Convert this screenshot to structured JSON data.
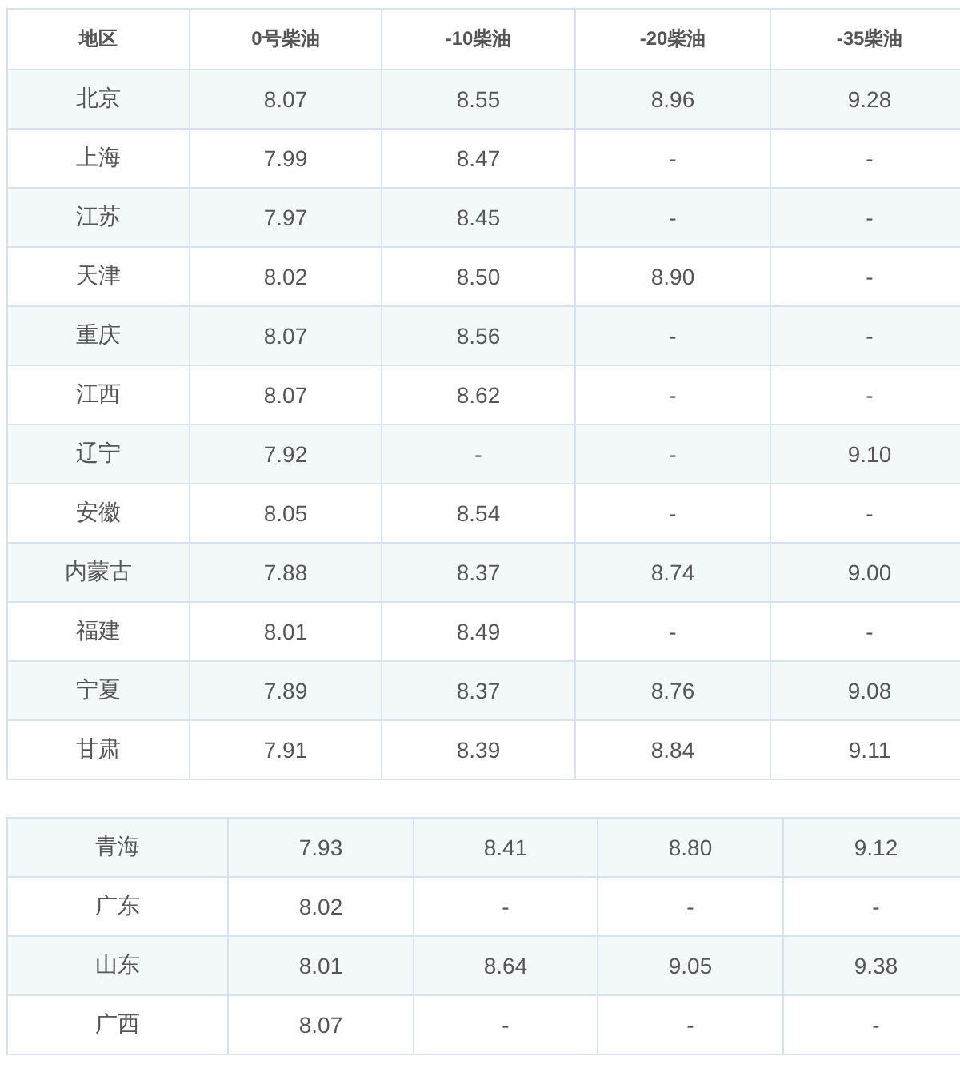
{
  "tables": [
    {
      "columns": [
        "地区",
        "0号柴油",
        "-10柴油",
        "-20柴油",
        "-35柴油"
      ],
      "rows": [
        [
          "北京",
          "8.07",
          "8.55",
          "8.96",
          "9.28"
        ],
        [
          "上海",
          "7.99",
          "8.47",
          "-",
          "-"
        ],
        [
          "江苏",
          "7.97",
          "8.45",
          "-",
          "-"
        ],
        [
          "天津",
          "8.02",
          "8.50",
          "8.90",
          "-"
        ],
        [
          "重庆",
          "8.07",
          "8.56",
          "-",
          "-"
        ],
        [
          "江西",
          "8.07",
          "8.62",
          "-",
          "-"
        ],
        [
          "辽宁",
          "7.92",
          "-",
          "-",
          "9.10"
        ],
        [
          "安徽",
          "8.05",
          "8.54",
          "-",
          "-"
        ],
        [
          "内蒙古",
          "7.88",
          "8.37",
          "8.74",
          "9.00"
        ],
        [
          "福建",
          "8.01",
          "8.49",
          "-",
          "-"
        ],
        [
          "宁夏",
          "7.89",
          "8.37",
          "8.76",
          "9.08"
        ],
        [
          "甘肃",
          "7.91",
          "8.39",
          "8.84",
          "9.11"
        ]
      ]
    },
    {
      "rows": [
        [
          "青海",
          "7.93",
          "8.41",
          "8.80",
          "9.12"
        ],
        [
          "广东",
          "8.02",
          "-",
          "-",
          "-"
        ],
        [
          "山东",
          "8.01",
          "8.64",
          "9.05",
          "9.38"
        ],
        [
          "广西",
          "8.07",
          "-",
          "-",
          "-"
        ]
      ]
    }
  ]
}
